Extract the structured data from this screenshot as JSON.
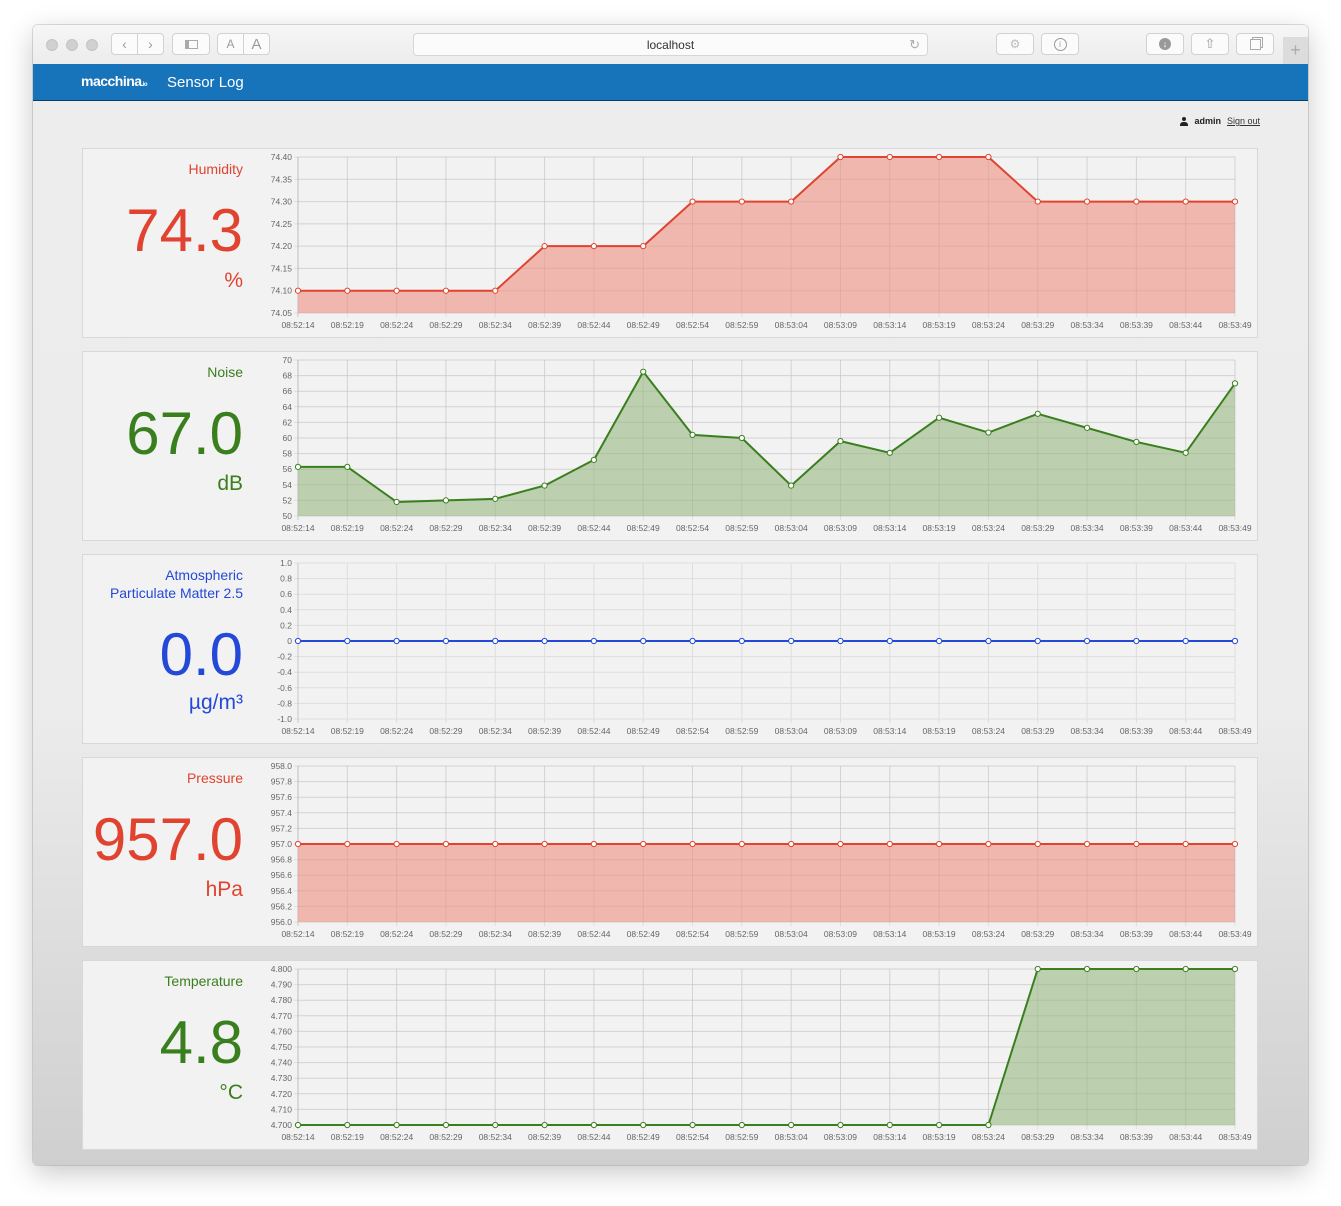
{
  "browser": {
    "url": "localhost",
    "icons": [
      "back-icon",
      "forward-icon",
      "sidebar-icon",
      "text-smaller-icon",
      "text-larger-icon",
      "reload-icon",
      "extension-icon",
      "info-icon",
      "download-icon",
      "share-icon",
      "tabs-icon",
      "new-tab-icon"
    ],
    "text_small": "A",
    "text_large": "A",
    "new_tab": "+"
  },
  "app": {
    "logo": "macchina",
    "logo_suffix": ".io",
    "title": "Sensor Log"
  },
  "user": {
    "name": "admin",
    "sign_out": "Sign out"
  },
  "colors": {
    "red": "#e0432f",
    "red_fill": "#efb3aa",
    "green": "#3a7f1e",
    "green_fill": "#b8ccaa",
    "blue": "#2448d8",
    "blue_fill": "#cfd6f3"
  },
  "chart_data": [
    {
      "type": "area",
      "title": "Humidity",
      "current_value": "74.3",
      "unit": "%",
      "color": "red",
      "fill": true,
      "x": [
        "08:52:14",
        "08:52:19",
        "08:52:24",
        "08:52:29",
        "08:52:34",
        "08:52:39",
        "08:52:44",
        "08:52:49",
        "08:52:54",
        "08:52:59",
        "08:53:04",
        "08:53:09",
        "08:53:14",
        "08:53:19",
        "08:53:24",
        "08:53:29",
        "08:53:34",
        "08:53:39",
        "08:53:44",
        "08:53:49"
      ],
      "values": [
        74.1,
        74.1,
        74.1,
        74.1,
        74.1,
        74.2,
        74.2,
        74.2,
        74.3,
        74.3,
        74.3,
        74.4,
        74.4,
        74.4,
        74.4,
        74.3,
        74.3,
        74.3,
        74.3,
        74.3
      ],
      "ylim": [
        74.05,
        74.4
      ],
      "yticks": [
        "74.40",
        "74.35",
        "74.30",
        "74.25",
        "74.20",
        "74.15",
        "74.10",
        "74.05"
      ],
      "grid": true
    },
    {
      "type": "area",
      "title": "Noise",
      "current_value": "67.0",
      "unit": "dB",
      "color": "green",
      "fill": true,
      "x": [
        "08:52:14",
        "08:52:19",
        "08:52:24",
        "08:52:29",
        "08:52:34",
        "08:52:39",
        "08:52:44",
        "08:52:49",
        "08:52:54",
        "08:52:59",
        "08:53:04",
        "08:53:09",
        "08:53:14",
        "08:53:19",
        "08:53:24",
        "08:53:29",
        "08:53:34",
        "08:53:39",
        "08:53:44",
        "08:53:49"
      ],
      "values": [
        56.3,
        56.3,
        51.8,
        52.0,
        52.2,
        53.9,
        57.2,
        68.5,
        60.4,
        60.0,
        53.9,
        59.6,
        58.1,
        62.6,
        60.7,
        63.1,
        61.3,
        59.5,
        58.1,
        67.0
      ],
      "ylim": [
        50,
        70
      ],
      "yticks": [
        "70",
        "68",
        "66",
        "64",
        "62",
        "60",
        "58",
        "56",
        "54",
        "52",
        "50"
      ],
      "grid": true
    },
    {
      "type": "line",
      "title": "Atmospheric Particulate Matter 2.5",
      "title_lines": [
        "Atmospheric",
        "Particulate Matter 2.5"
      ],
      "current_value": "0.0",
      "unit": "µg/m³",
      "color": "blue",
      "fill": false,
      "x": [
        "08:52:14",
        "08:52:19",
        "08:52:24",
        "08:52:29",
        "08:52:34",
        "08:52:39",
        "08:52:44",
        "08:52:49",
        "08:52:54",
        "08:52:59",
        "08:53:04",
        "08:53:09",
        "08:53:14",
        "08:53:19",
        "08:53:24",
        "08:53:29",
        "08:53:34",
        "08:53:39",
        "08:53:44",
        "08:53:49"
      ],
      "values": [
        0,
        0,
        0,
        0,
        0,
        0,
        0,
        0,
        0,
        0,
        0,
        0,
        0,
        0,
        0,
        0,
        0,
        0,
        0,
        0
      ],
      "ylim": [
        -1.0,
        1.0
      ],
      "yticks": [
        "1.0",
        "0.8",
        "0.6",
        "0.4",
        "0.2",
        "0",
        "-0.2",
        "-0.4",
        "-0.6",
        "-0.8",
        "-1.0"
      ],
      "grid": true
    },
    {
      "type": "area",
      "title": "Pressure",
      "current_value": "957.0",
      "unit": "hPa",
      "color": "red",
      "fill": true,
      "x": [
        "08:52:14",
        "08:52:19",
        "08:52:24",
        "08:52:29",
        "08:52:34",
        "08:52:39",
        "08:52:44",
        "08:52:49",
        "08:52:54",
        "08:52:59",
        "08:53:04",
        "08:53:09",
        "08:53:14",
        "08:53:19",
        "08:53:24",
        "08:53:29",
        "08:53:34",
        "08:53:39",
        "08:53:44",
        "08:53:49"
      ],
      "values": [
        957.0,
        957.0,
        957.0,
        957.0,
        957.0,
        957.0,
        957.0,
        957.0,
        957.0,
        957.0,
        957.0,
        957.0,
        957.0,
        957.0,
        957.0,
        957.0,
        957.0,
        957.0,
        957.0,
        957.0
      ],
      "ylim": [
        956.0,
        958.0
      ],
      "yticks": [
        "958.0",
        "957.8",
        "957.6",
        "957.4",
        "957.2",
        "957.0",
        "956.8",
        "956.6",
        "956.4",
        "956.2",
        "956.0"
      ],
      "grid": true
    },
    {
      "type": "area",
      "title": "Temperature",
      "current_value": "4.8",
      "unit": "°C",
      "color": "green",
      "fill": true,
      "x": [
        "08:52:14",
        "08:52:19",
        "08:52:24",
        "08:52:29",
        "08:52:34",
        "08:52:39",
        "08:52:44",
        "08:52:49",
        "08:52:54",
        "08:52:59",
        "08:53:04",
        "08:53:09",
        "08:53:14",
        "08:53:19",
        "08:53:24",
        "08:53:29",
        "08:53:34",
        "08:53:39",
        "08:53:44",
        "08:53:49"
      ],
      "values": [
        4.7,
        4.7,
        4.7,
        4.7,
        4.7,
        4.7,
        4.7,
        4.7,
        4.7,
        4.7,
        4.7,
        4.7,
        4.7,
        4.7,
        4.7,
        4.8,
        4.8,
        4.8,
        4.8,
        4.8
      ],
      "ylim": [
        4.7,
        4.8
      ],
      "yticks": [
        "4.800",
        "4.790",
        "4.780",
        "4.770",
        "4.760",
        "4.750",
        "4.740",
        "4.730",
        "4.720",
        "4.710",
        "4.700"
      ],
      "grid": true
    }
  ]
}
